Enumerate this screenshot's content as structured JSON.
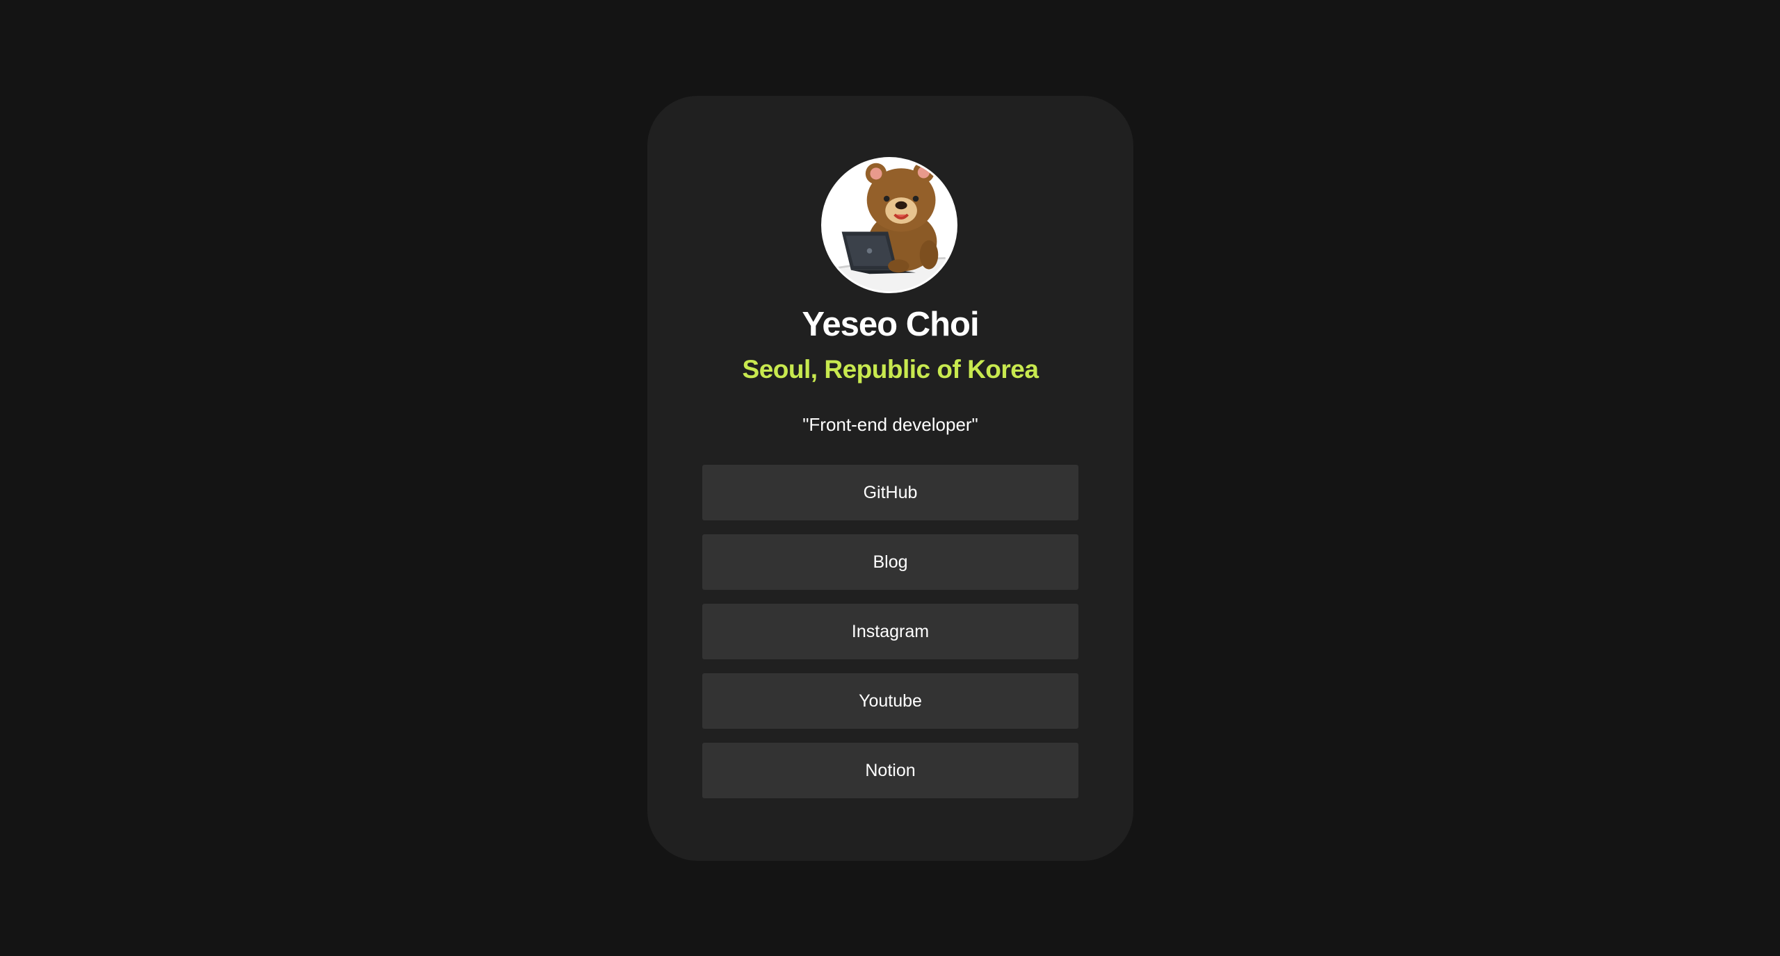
{
  "profile": {
    "name": "Yeseo Choi",
    "location": "Seoul, Republic of Korea",
    "bio": "\"Front-end developer\"",
    "avatar_icon": "bear-with-laptop-avatar"
  },
  "links": [
    {
      "label": "GitHub"
    },
    {
      "label": "Blog"
    },
    {
      "label": "Instagram"
    },
    {
      "label": "Youtube"
    },
    {
      "label": "Notion"
    }
  ],
  "colors": {
    "background": "#141414",
    "card": "#202020",
    "button": "#333333",
    "accent": "#c8e94f",
    "text": "#ffffff"
  }
}
